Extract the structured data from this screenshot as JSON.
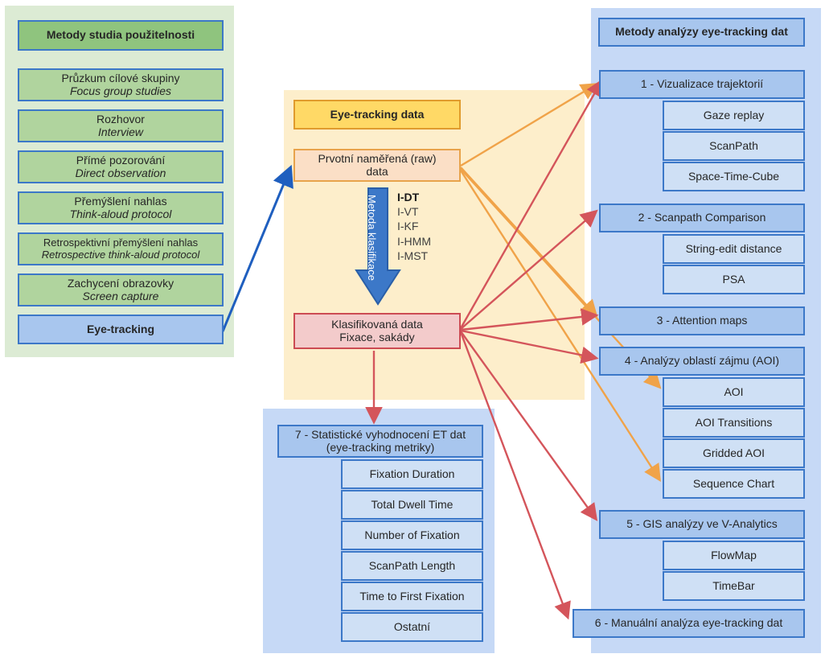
{
  "diagram": {
    "title": "Eye-tracking usability methods and analysis methods diagram",
    "colors": {
      "green_panel": "#DCEBD4",
      "yellow_panel": "#FDEECB",
      "blue_panel": "#C6D9F6",
      "box_border_blue": "#3C78C8",
      "green_header_fill": "#8FC47E",
      "green_item_fill": "#B0D49E",
      "blue_box_fill": "#A8C6EE",
      "sub_box_fill": "#CFE0F5",
      "yellow_header_fill": "#FFD966",
      "raw_data_fill": "#FBDFC6",
      "classified_fill": "#F3CBCB",
      "arrow_blue": "#1F5FBF",
      "arrow_orange": "#F0A349",
      "arrow_red": "#D4555B"
    }
  },
  "usability": {
    "header": "Metody studia použitelnosti",
    "items": [
      {
        "cs": "Průzkum cílové skupiny",
        "en": "Focus group studies"
      },
      {
        "cs": "Rozhovor",
        "en": "Interview"
      },
      {
        "cs": "Přímé pozorování",
        "en": "Direct observation"
      },
      {
        "cs": "Přemýšlení nahlas",
        "en": "Think-aloud protocol"
      },
      {
        "cs": "Retrospektivní přemýšlení nahlas",
        "en": "Retrospective think-aloud protocol"
      },
      {
        "cs": "Zachycení obrazovky",
        "en": "Screen capture"
      }
    ],
    "highlight": "Eye-tracking"
  },
  "center": {
    "header": "Eye-tracking data",
    "raw": {
      "line1": "Prvotní naměřená (raw)",
      "line2": "data"
    },
    "arrow_label": "Metoda klasifikace",
    "methods": [
      "I-DT",
      "I-VT",
      "I-KF",
      "I-HMM",
      "I-MST"
    ],
    "methods_bold_index": 0,
    "classified": {
      "line1": "Klasifikovaná data",
      "line2": "Fixace, sakády"
    }
  },
  "analysis": {
    "header": "Metody analýzy eye-tracking dat",
    "categories": [
      {
        "label": "1 - Vizualizace trajektorií",
        "items": [
          "Gaze replay",
          "ScanPath",
          "Space-Time-Cube"
        ]
      },
      {
        "label": "2 - Scanpath Comparison",
        "items": [
          "String-edit distance",
          "PSA"
        ]
      },
      {
        "label": "3 - Attention maps",
        "items": []
      },
      {
        "label": "4 - Analýzy oblastí zájmu (AOI)",
        "items": [
          "AOI",
          "AOI Transitions",
          "Gridded AOI",
          "Sequence Chart"
        ]
      },
      {
        "label": "5 - GIS analýzy ve V-Analytics",
        "items": [
          "FlowMap",
          "TimeBar"
        ]
      },
      {
        "label": "6 - Manuální analýza eye-tracking dat",
        "items": []
      }
    ]
  },
  "statistics": {
    "header": {
      "line1": "7 - Statistické vyhodnocení ET dat",
      "line2": "(eye-tracking metriky)"
    },
    "items": [
      "Fixation Duration",
      "Total Dwell Time",
      "Number of Fixation",
      "ScanPath Length",
      "Time to First Fixation",
      "Ostatní"
    ]
  }
}
